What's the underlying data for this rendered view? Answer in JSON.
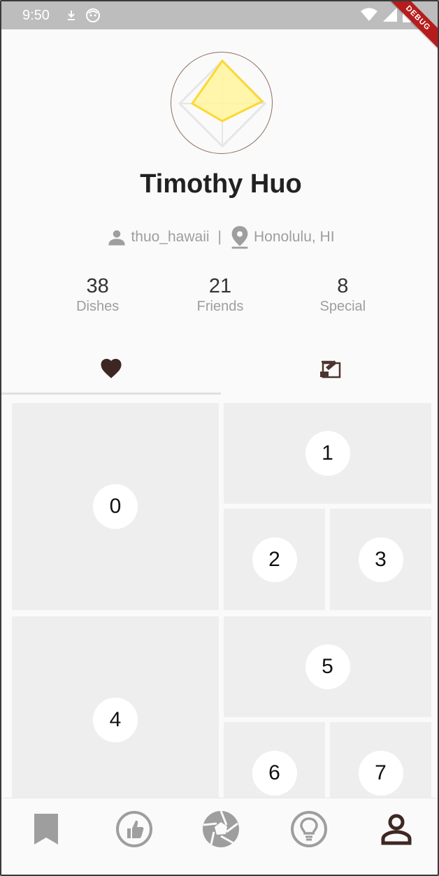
{
  "status_bar": {
    "time": "9:50",
    "debug_label": "DEBUG"
  },
  "profile": {
    "name": "Timothy Huo",
    "username": "thuo_hawaii",
    "separator": "|",
    "location": "Honolulu, HI"
  },
  "stats": [
    {
      "value": "38",
      "label": "Dishes"
    },
    {
      "value": "21",
      "label": "Friends"
    },
    {
      "value": "8",
      "label": "Special"
    }
  ],
  "tabs": [
    {
      "icon": "heart-icon",
      "selected": true
    },
    {
      "icon": "edit-document-icon",
      "selected": false
    }
  ],
  "grid_tiles": [
    "0",
    "1",
    "2",
    "3",
    "4",
    "5",
    "6",
    "7"
  ],
  "bottom_nav": [
    {
      "icon": "bookmark-icon",
      "selected": false
    },
    {
      "icon": "thumbs-up-icon",
      "selected": false
    },
    {
      "icon": "camera-shutter-icon",
      "selected": false
    },
    {
      "icon": "lightbulb-icon",
      "selected": false
    },
    {
      "icon": "person-icon",
      "selected": true
    }
  ],
  "colors": {
    "accent_dark": "#3e2723",
    "inactive_icon": "#9e9e9e",
    "tile_bg": "#eeeeee",
    "radar_fill": "#fff59d",
    "radar_stroke": "#fdd835"
  }
}
